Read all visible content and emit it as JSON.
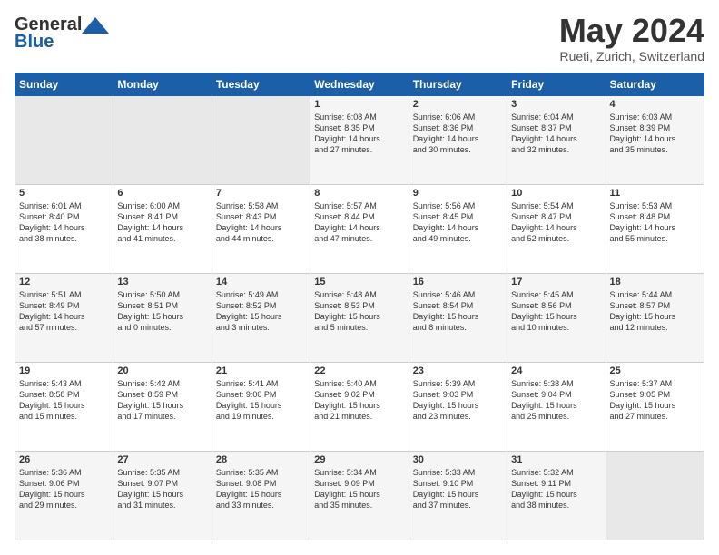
{
  "logo": {
    "line1": "General",
    "line2": "Blue"
  },
  "header": {
    "month": "May 2024",
    "location": "Rueti, Zurich, Switzerland"
  },
  "weekdays": [
    "Sunday",
    "Monday",
    "Tuesday",
    "Wednesday",
    "Thursday",
    "Friday",
    "Saturday"
  ],
  "weeks": [
    [
      {
        "day": "",
        "info": ""
      },
      {
        "day": "",
        "info": ""
      },
      {
        "day": "",
        "info": ""
      },
      {
        "day": "1",
        "info": "Sunrise: 6:08 AM\nSunset: 8:35 PM\nDaylight: 14 hours\nand 27 minutes."
      },
      {
        "day": "2",
        "info": "Sunrise: 6:06 AM\nSunset: 8:36 PM\nDaylight: 14 hours\nand 30 minutes."
      },
      {
        "day": "3",
        "info": "Sunrise: 6:04 AM\nSunset: 8:37 PM\nDaylight: 14 hours\nand 32 minutes."
      },
      {
        "day": "4",
        "info": "Sunrise: 6:03 AM\nSunset: 8:39 PM\nDaylight: 14 hours\nand 35 minutes."
      }
    ],
    [
      {
        "day": "5",
        "info": "Sunrise: 6:01 AM\nSunset: 8:40 PM\nDaylight: 14 hours\nand 38 minutes."
      },
      {
        "day": "6",
        "info": "Sunrise: 6:00 AM\nSunset: 8:41 PM\nDaylight: 14 hours\nand 41 minutes."
      },
      {
        "day": "7",
        "info": "Sunrise: 5:58 AM\nSunset: 8:43 PM\nDaylight: 14 hours\nand 44 minutes."
      },
      {
        "day": "8",
        "info": "Sunrise: 5:57 AM\nSunset: 8:44 PM\nDaylight: 14 hours\nand 47 minutes."
      },
      {
        "day": "9",
        "info": "Sunrise: 5:56 AM\nSunset: 8:45 PM\nDaylight: 14 hours\nand 49 minutes."
      },
      {
        "day": "10",
        "info": "Sunrise: 5:54 AM\nSunset: 8:47 PM\nDaylight: 14 hours\nand 52 minutes."
      },
      {
        "day": "11",
        "info": "Sunrise: 5:53 AM\nSunset: 8:48 PM\nDaylight: 14 hours\nand 55 minutes."
      }
    ],
    [
      {
        "day": "12",
        "info": "Sunrise: 5:51 AM\nSunset: 8:49 PM\nDaylight: 14 hours\nand 57 minutes."
      },
      {
        "day": "13",
        "info": "Sunrise: 5:50 AM\nSunset: 8:51 PM\nDaylight: 15 hours\nand 0 minutes."
      },
      {
        "day": "14",
        "info": "Sunrise: 5:49 AM\nSunset: 8:52 PM\nDaylight: 15 hours\nand 3 minutes."
      },
      {
        "day": "15",
        "info": "Sunrise: 5:48 AM\nSunset: 8:53 PM\nDaylight: 15 hours\nand 5 minutes."
      },
      {
        "day": "16",
        "info": "Sunrise: 5:46 AM\nSunset: 8:54 PM\nDaylight: 15 hours\nand 8 minutes."
      },
      {
        "day": "17",
        "info": "Sunrise: 5:45 AM\nSunset: 8:56 PM\nDaylight: 15 hours\nand 10 minutes."
      },
      {
        "day": "18",
        "info": "Sunrise: 5:44 AM\nSunset: 8:57 PM\nDaylight: 15 hours\nand 12 minutes."
      }
    ],
    [
      {
        "day": "19",
        "info": "Sunrise: 5:43 AM\nSunset: 8:58 PM\nDaylight: 15 hours\nand 15 minutes."
      },
      {
        "day": "20",
        "info": "Sunrise: 5:42 AM\nSunset: 8:59 PM\nDaylight: 15 hours\nand 17 minutes."
      },
      {
        "day": "21",
        "info": "Sunrise: 5:41 AM\nSunset: 9:00 PM\nDaylight: 15 hours\nand 19 minutes."
      },
      {
        "day": "22",
        "info": "Sunrise: 5:40 AM\nSunset: 9:02 PM\nDaylight: 15 hours\nand 21 minutes."
      },
      {
        "day": "23",
        "info": "Sunrise: 5:39 AM\nSunset: 9:03 PM\nDaylight: 15 hours\nand 23 minutes."
      },
      {
        "day": "24",
        "info": "Sunrise: 5:38 AM\nSunset: 9:04 PM\nDaylight: 15 hours\nand 25 minutes."
      },
      {
        "day": "25",
        "info": "Sunrise: 5:37 AM\nSunset: 9:05 PM\nDaylight: 15 hours\nand 27 minutes."
      }
    ],
    [
      {
        "day": "26",
        "info": "Sunrise: 5:36 AM\nSunset: 9:06 PM\nDaylight: 15 hours\nand 29 minutes."
      },
      {
        "day": "27",
        "info": "Sunrise: 5:35 AM\nSunset: 9:07 PM\nDaylight: 15 hours\nand 31 minutes."
      },
      {
        "day": "28",
        "info": "Sunrise: 5:35 AM\nSunset: 9:08 PM\nDaylight: 15 hours\nand 33 minutes."
      },
      {
        "day": "29",
        "info": "Sunrise: 5:34 AM\nSunset: 9:09 PM\nDaylight: 15 hours\nand 35 minutes."
      },
      {
        "day": "30",
        "info": "Sunrise: 5:33 AM\nSunset: 9:10 PM\nDaylight: 15 hours\nand 37 minutes."
      },
      {
        "day": "31",
        "info": "Sunrise: 5:32 AM\nSunset: 9:11 PM\nDaylight: 15 hours\nand 38 minutes."
      },
      {
        "day": "",
        "info": ""
      }
    ]
  ]
}
